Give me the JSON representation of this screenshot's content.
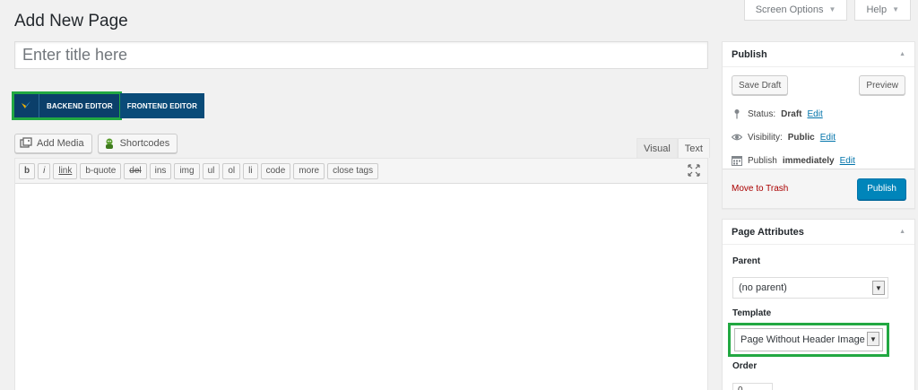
{
  "screen_meta": {
    "screen_options": "Screen Options",
    "help": "Help"
  },
  "page_title": "Add New Page",
  "title_field": {
    "placeholder": "Enter title here",
    "value": ""
  },
  "vc": {
    "backend": "BACKEND EDITOR",
    "frontend": "FRONTEND EDITOR",
    "highlight_color": "#22a842"
  },
  "media": {
    "add_media": "Add Media",
    "shortcodes": "Shortcodes"
  },
  "editor_tabs": [
    "Visual",
    "Text"
  ],
  "quicktags": [
    "b",
    "i",
    "link",
    "b-quote",
    "del",
    "ins",
    "img",
    "ul",
    "ol",
    "li",
    "code",
    "more",
    "close tags"
  ],
  "publish": {
    "title": "Publish",
    "save_draft": "Save Draft",
    "preview": "Preview",
    "status_label": "Status:",
    "status_value": "Draft",
    "visibility_label": "Visibility:",
    "visibility_value": "Public",
    "publish_label": "Publish",
    "publish_value": "immediately",
    "edit": "Edit",
    "move_to_trash": "Move to Trash",
    "publish_button": "Publish"
  },
  "attributes": {
    "title": "Page Attributes",
    "parent_label": "Parent",
    "parent_value": "(no parent)",
    "template_label": "Template",
    "template_value": "Page Without Header Image",
    "order_label": "Order",
    "order_value": "0"
  }
}
